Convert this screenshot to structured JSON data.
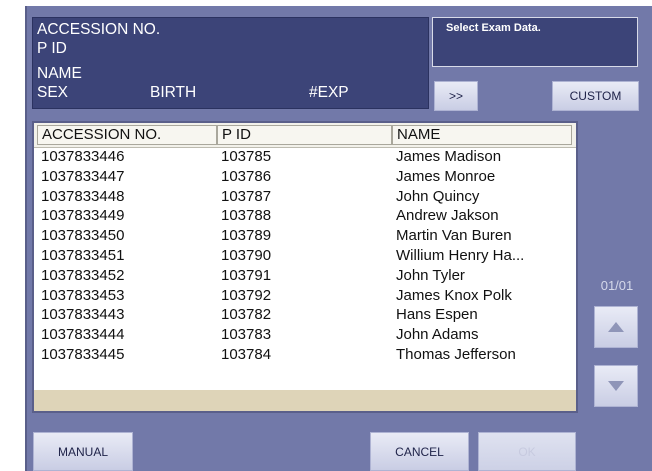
{
  "info": {
    "accession_label": "ACCESSION NO.",
    "pid_label": "P ID",
    "name_label": "NAME",
    "sex_label": "SEX",
    "birth_label": "BIRTH",
    "exp_label": "#EXP"
  },
  "select_exam": {
    "title": "Select Exam Data."
  },
  "buttons": {
    "more": ">>",
    "custom": "CUSTOM",
    "manual": "MANUAL",
    "cancel": "CANCEL",
    "ok": "OK"
  },
  "table": {
    "columns": [
      "ACCESSION NO.",
      "P ID",
      "NAME"
    ],
    "rows": [
      {
        "accession": "1037833446",
        "pid": "103785",
        "name": "James Madison"
      },
      {
        "accession": "1037833447",
        "pid": "103786",
        "name": "James Monroe"
      },
      {
        "accession": "1037833448",
        "pid": "103787",
        "name": "John Quincy"
      },
      {
        "accession": "1037833449",
        "pid": "103788",
        "name": "Andrew Jakson"
      },
      {
        "accession": "1037833450",
        "pid": "103789",
        "name": "Martin Van Buren"
      },
      {
        "accession": "1037833451",
        "pid": "103790",
        "name": "Willium Henry Ha..."
      },
      {
        "accession": "1037833452",
        "pid": "103791",
        "name": "John Tyler"
      },
      {
        "accession": "1037833453",
        "pid": "103792",
        "name": "James Knox Polk"
      },
      {
        "accession": "1037833443",
        "pid": "103782",
        "name": "Hans Espen"
      },
      {
        "accession": "1037833444",
        "pid": "103783",
        "name": "John Adams"
      },
      {
        "accession": "1037833445",
        "pid": "103784",
        "name": "Thomas Jefferson"
      }
    ]
  },
  "pagination": {
    "indicator": "01/01"
  },
  "icons": {
    "up": "arrow-up-icon",
    "down": "arrow-down-icon"
  },
  "colors": {
    "panel": "#7279a9",
    "info_box": "#3c4478",
    "table_footer": "#ded4b8"
  }
}
